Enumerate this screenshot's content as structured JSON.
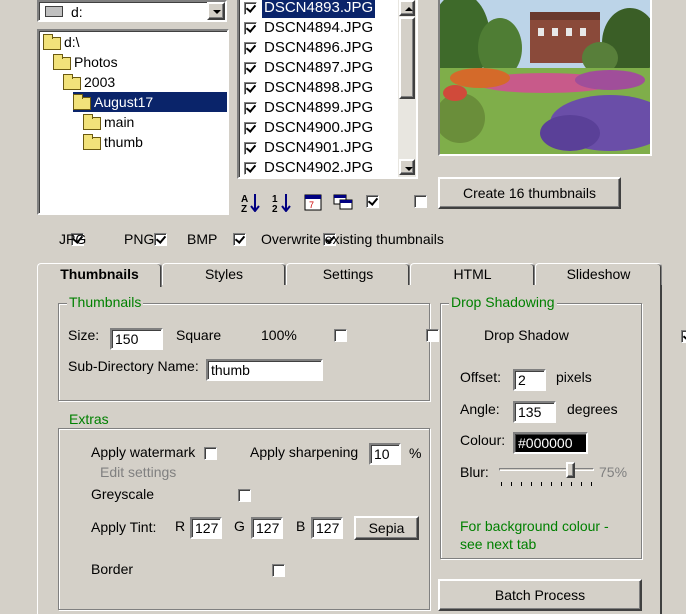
{
  "drive_select": {
    "value": "d:"
  },
  "tree": {
    "items": [
      {
        "label": "d:\\",
        "indent": 0,
        "selected": false
      },
      {
        "label": "Photos",
        "indent": 1,
        "selected": false
      },
      {
        "label": "2003",
        "indent": 2,
        "selected": false
      },
      {
        "label": "August17",
        "indent": 3,
        "selected": true
      },
      {
        "label": "main",
        "indent": 4,
        "selected": false
      },
      {
        "label": "thumb",
        "indent": 4,
        "selected": false
      }
    ]
  },
  "files": {
    "items": [
      {
        "name": "DSCN4893.JPG",
        "checked": true,
        "selected": true
      },
      {
        "name": "DSCN4894.JPG",
        "checked": true,
        "selected": false
      },
      {
        "name": "DSCN4896.JPG",
        "checked": true,
        "selected": false
      },
      {
        "name": "DSCN4897.JPG",
        "checked": true,
        "selected": false
      },
      {
        "name": "DSCN4898.JPG",
        "checked": true,
        "selected": false
      },
      {
        "name": "DSCN4899.JPG",
        "checked": true,
        "selected": false
      },
      {
        "name": "DSCN4900.JPG",
        "checked": true,
        "selected": false
      },
      {
        "name": "DSCN4901.JPG",
        "checked": true,
        "selected": false
      },
      {
        "name": "DSCN4902.JPG",
        "checked": true,
        "selected": false
      }
    ]
  },
  "toolbar": {
    "icons": [
      "sort-ascending-icon",
      "sort-descending-icon",
      "calendar-icon",
      "windows-icon",
      "check-all-icon",
      "uncheck-all-icon"
    ]
  },
  "create_button": {
    "label": "Create 16 thumbnails"
  },
  "filetypes": {
    "jpg": {
      "label": "JPG",
      "checked": true
    },
    "png": {
      "label": "PNG",
      "checked": true
    },
    "bmp": {
      "label": "BMP",
      "checked": true
    },
    "overwrite": {
      "label": "Overwrite existing thumbnails",
      "checked": true
    }
  },
  "tabs": [
    {
      "label": "Thumbnails",
      "active": true
    },
    {
      "label": "Styles",
      "active": false
    },
    {
      "label": "Settings",
      "active": false
    },
    {
      "label": "HTML",
      "active": false
    },
    {
      "label": "Slideshow",
      "active": false
    }
  ],
  "thumbnails_group": {
    "title": "Thumbnails",
    "size_label": "Size:",
    "size_value": "150",
    "square_label": "Square",
    "square_checked": false,
    "percent_label": "100%",
    "percent_checked": false,
    "subdir_label": "Sub-Directory Name:",
    "subdir_value": "thumb"
  },
  "extras_group": {
    "title": "Extras",
    "watermark_label": "Apply watermark",
    "watermark_checked": false,
    "edit_settings_label": "Edit settings",
    "sharpening_label": "Apply sharpening",
    "sharpening_checked": false,
    "sharpening_value": "10",
    "sharpening_unit": "%",
    "greyscale_label": "Greyscale",
    "greyscale_checked": false,
    "tint_label": "Apply Tint:",
    "tint_checked": false,
    "r_label": "R",
    "r_value": "127",
    "g_label": "G",
    "g_value": "127",
    "b_label": "B",
    "b_value": "127",
    "sepia_label": "Sepia",
    "border_label": "Border",
    "border_checked": false
  },
  "shadow_group": {
    "title": "Drop Shadowing",
    "drop_shadow_label": "Drop Shadow",
    "drop_shadow_checked": true,
    "offset_label": "Offset:",
    "offset_value": "2",
    "offset_unit": "pixels",
    "angle_label": "Angle:",
    "angle_value": "135",
    "angle_unit": "degrees",
    "colour_label": "Colour:",
    "colour_value": "#000000",
    "blur_label": "Blur:",
    "blur_value": "75%",
    "blur_level": 0.75,
    "note": "For background colour - see next tab"
  },
  "batch_button": {
    "label": "Batch Process"
  },
  "colors": {
    "face": "#d4d0c8",
    "selection": "#0a246a",
    "group_title": "#008000",
    "disabled_text": "#808080"
  }
}
